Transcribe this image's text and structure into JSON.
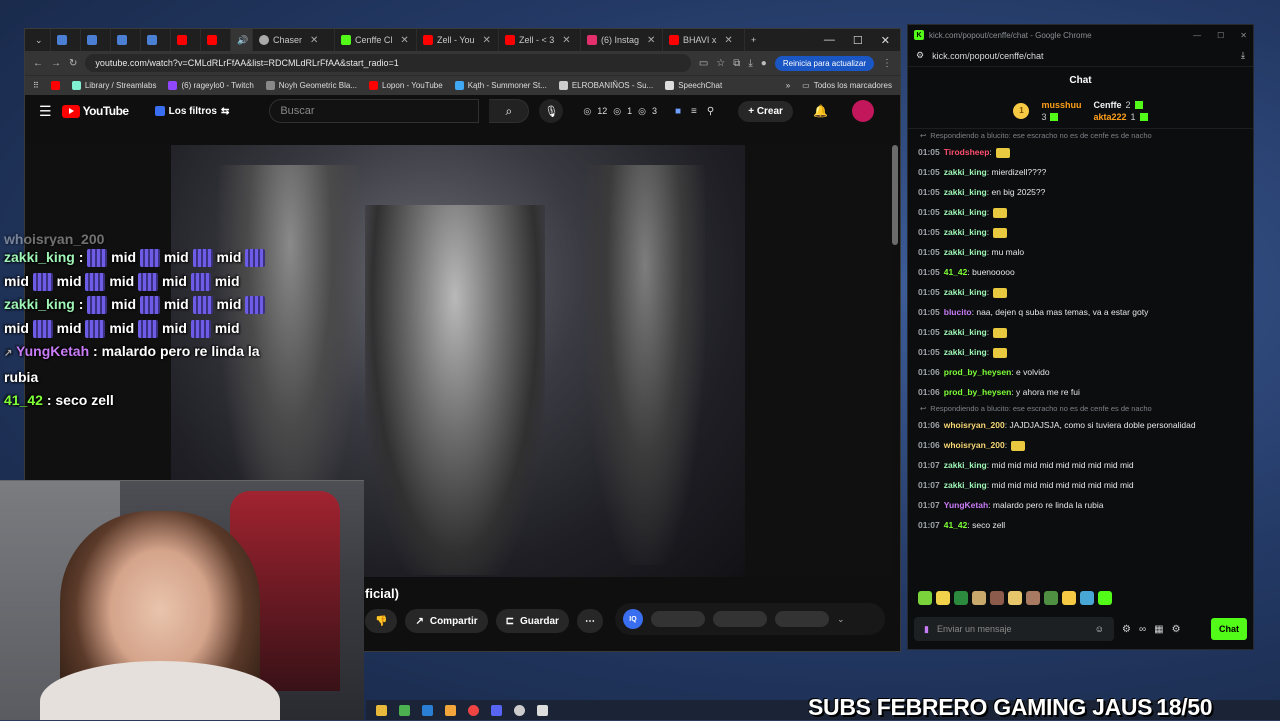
{
  "browser": {
    "tabs": [
      {
        "label": "Chaser",
        "color": "#aaaaaa"
      },
      {
        "label": "Cenffe Cl",
        "color": "#53fc18"
      },
      {
        "label": "Zell - You",
        "color": "#ff0000"
      },
      {
        "label": "Zell - < 3",
        "color": "#ff0000"
      },
      {
        "label": "(6) Instag",
        "color": "#e1306c"
      },
      {
        "label": "BHAVI x",
        "color": "#ff0000"
      }
    ],
    "url": "youtube.com/watch?v=CMLdRLrFfAA&list=RDCMLdRLrFfAA&start_radio=1",
    "update_label": "Reinicia para actualizar",
    "bookmarks": [
      {
        "label": "Library / Streamlabs",
        "color": "#80f2d3"
      },
      {
        "label": "(6) rageylo0 - Twitch",
        "color": "#9146ff"
      },
      {
        "label": "Noyh Geometric Bla...",
        "color": "#888888"
      },
      {
        "label": "Lopon - YouTube",
        "color": "#ff0000"
      },
      {
        "label": "Kąth - Summoner St...",
        "color": "#3fa9f5"
      },
      {
        "label": "ELROBANIÑOS - Su...",
        "color": "#cccccc"
      },
      {
        "label": "SpeechChat",
        "color": "#dddddd"
      }
    ],
    "bookmarks_folder": "Todos los marcadores"
  },
  "youtube": {
    "logo": "YouTube",
    "filters_label": "Los filtros",
    "search_placeholder": "Buscar",
    "stat1": "12",
    "stat2": "1",
    "stat3": "3",
    "create_label": "Crear",
    "video_title_fragment": "ficial)",
    "share_label": "Compartir",
    "save_label": "Guardar"
  },
  "kick": {
    "window_title": "kick.com/popout/cenffe/chat - Google Chrome",
    "url": "kick.com/popout/cenffe/chat",
    "chat_title": "Chat",
    "leaderboard": [
      {
        "name": "musshuu",
        "count": "3"
      },
      {
        "name": "Cenffe",
        "count": "2"
      },
      {
        "name": "akta222",
        "count": "1"
      }
    ],
    "replying_1": "Respondiendo a blucito: ese escracho no es de cenfe es de nacho",
    "replying_2": "Respondiendo a blucito: ese escracho no es de cenfe es de nacho",
    "messages": [
      {
        "time": "01:05",
        "user": "Tirodsheep",
        "text": "",
        "color": "#ff4d6d"
      },
      {
        "time": "01:05",
        "user": "zakki_king",
        "text": "mierdizell????",
        "color": "#9ff5b5"
      },
      {
        "time": "01:05",
        "user": "zakki_king",
        "text": "en big 2025??",
        "color": "#9ff5b5"
      },
      {
        "time": "01:05",
        "user": "zakki_king",
        "text": "",
        "color": "#9ff5b5"
      },
      {
        "time": "01:05",
        "user": "zakki_king",
        "text": "",
        "color": "#9ff5b5"
      },
      {
        "time": "01:05",
        "user": "zakki_king",
        "text": "mu malo",
        "color": "#9ff5b5"
      },
      {
        "time": "01:05",
        "user": "41_42",
        "text": "buenooooo",
        "color": "#7eff36"
      },
      {
        "time": "01:05",
        "user": "zakki_king",
        "text": "",
        "color": "#9ff5b5"
      },
      {
        "time": "01:05",
        "user": "blucito",
        "text": "naa, dejen q suba mas temas, va a estar goty",
        "color": "#c97cf7"
      },
      {
        "time": "01:05",
        "user": "zakki_king",
        "text": "",
        "color": "#9ff5b5"
      },
      {
        "time": "01:05",
        "user": "zakki_king",
        "text": "",
        "color": "#9ff5b5"
      },
      {
        "time": "01:06",
        "user": "prod_by_heysen",
        "text": "e volvido",
        "color": "#7eff36"
      },
      {
        "time": "01:06",
        "user": "prod_by_heysen",
        "text": "y ahora me re fui",
        "color": "#7eff36"
      }
    ],
    "messages2": [
      {
        "time": "01:06",
        "user": "whoisryan_200",
        "text": "JAJDJAJSJA, como si tuviera doble personalidad",
        "color": "#f7d774"
      },
      {
        "time": "01:06",
        "user": "whoisryan_200",
        "text": "",
        "color": "#f7d774"
      },
      {
        "time": "01:07",
        "user": "zakki_king",
        "text": "mid mid mid mid mid mid mid mid mid",
        "color": "#9ff5b5"
      },
      {
        "time": "01:07",
        "user": "zakki_king",
        "text": "mid mid mid mid mid mid mid mid mid",
        "color": "#9ff5b5"
      },
      {
        "time": "01:07",
        "user": "YungKetah",
        "text": "malardo pero re linda la rubia",
        "color": "#c97cf7"
      },
      {
        "time": "01:07",
        "user": "41_42",
        "text": "seco zell",
        "color": "#7eff36"
      }
    ],
    "input_placeholder": "Enviar un mensaje",
    "send_label": "Chat"
  },
  "overlay_chat": {
    "line1_user": "zakki_king",
    "line1_text": "mid",
    "line2_user": "zakki_king",
    "line3_user": "YungKetah",
    "line3_text": "malardo pero re linda la rubia",
    "line4_user": "41_42",
    "line4_text": "seco zell",
    "partial_top": "whoisryan_200"
  },
  "banner": {
    "text": "SUBS FEBRERO GAMING JAUS",
    "count": "18/50"
  }
}
